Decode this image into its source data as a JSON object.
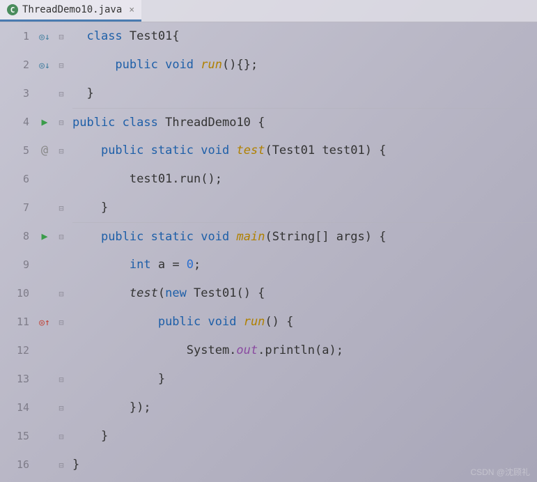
{
  "tab": {
    "icon_text": "C",
    "filename": "ThreadDemo10.java",
    "close": "×"
  },
  "lines": {
    "1": {
      "num": "1"
    },
    "2": {
      "num": "2"
    },
    "3": {
      "num": "3"
    },
    "4": {
      "num": "4"
    },
    "5": {
      "num": "5"
    },
    "6": {
      "num": "6"
    },
    "7": {
      "num": "7"
    },
    "8": {
      "num": "8"
    },
    "9": {
      "num": "9"
    },
    "10": {
      "num": "10"
    },
    "11": {
      "num": "11"
    },
    "12": {
      "num": "12"
    },
    "13": {
      "num": "13"
    },
    "14": {
      "num": "14"
    },
    "15": {
      "num": "15"
    },
    "16": {
      "num": "16"
    }
  },
  "gutterIcons": {
    "1": "◎↓",
    "2": "◎↓",
    "4": "▶",
    "5": "@",
    "8": "▶",
    "11": "◎↑"
  },
  "fold": {
    "1": "⊟",
    "2": "⊟",
    "3": "⊟",
    "4": "⊟",
    "5": "⊟",
    "7": "⊟",
    "8": "⊟",
    "10": "⊟",
    "11": "⊟",
    "13": "⊟",
    "14": "⊟",
    "15": "⊟",
    "16": "⊟"
  },
  "code": {
    "l1": {
      "kw1": "class",
      "name": " Test01{",
      "indent": "  "
    },
    "l2": {
      "indent": "      ",
      "kw1": "public",
      "sp1": " ",
      "kw2": "void",
      "sp2": " ",
      "method": "run",
      "rest": "(){};"
    },
    "l3": {
      "indent": "  ",
      "text": "}"
    },
    "l4": {
      "kw1": "public",
      "sp1": " ",
      "kw2": "class",
      "name": " ThreadDemo10 {"
    },
    "l5": {
      "indent": "    ",
      "kw1": "public",
      "sp1": " ",
      "kw2": "static",
      "sp2": " ",
      "kw3": "void",
      "sp3": " ",
      "method": "test",
      "rest": "(Test01 test01) {"
    },
    "l6": {
      "indent": "        ",
      "text": "test01.run();"
    },
    "l7": {
      "indent": "    ",
      "text": "}"
    },
    "l8": {
      "indent": "    ",
      "kw1": "public",
      "sp1": " ",
      "kw2": "static",
      "sp2": " ",
      "kw3": "void",
      "sp3": " ",
      "method": "main",
      "rest": "(String[] args) {"
    },
    "l9": {
      "indent": "        ",
      "kw1": "int",
      "text": " a = ",
      "num": "0",
      "semi": ";"
    },
    "l10": {
      "indent": "        ",
      "call": "test",
      "open": "(",
      "kw1": "new",
      "text": " Test01() {"
    },
    "l11": {
      "indent": "            ",
      "kw1": "public",
      "sp1": " ",
      "kw2": "void",
      "sp2": " ",
      "method": "run",
      "rest": "() {"
    },
    "l12": {
      "indent": "                ",
      "cls": "System.",
      "field": "out",
      "rest": ".println(a);"
    },
    "l13": {
      "indent": "            ",
      "text": "}"
    },
    "l14": {
      "indent": "        ",
      "text": "});"
    },
    "l15": {
      "indent": "    ",
      "text": "}"
    },
    "l16": {
      "text": "}"
    }
  },
  "watermark": "CSDN @沈顾礼"
}
